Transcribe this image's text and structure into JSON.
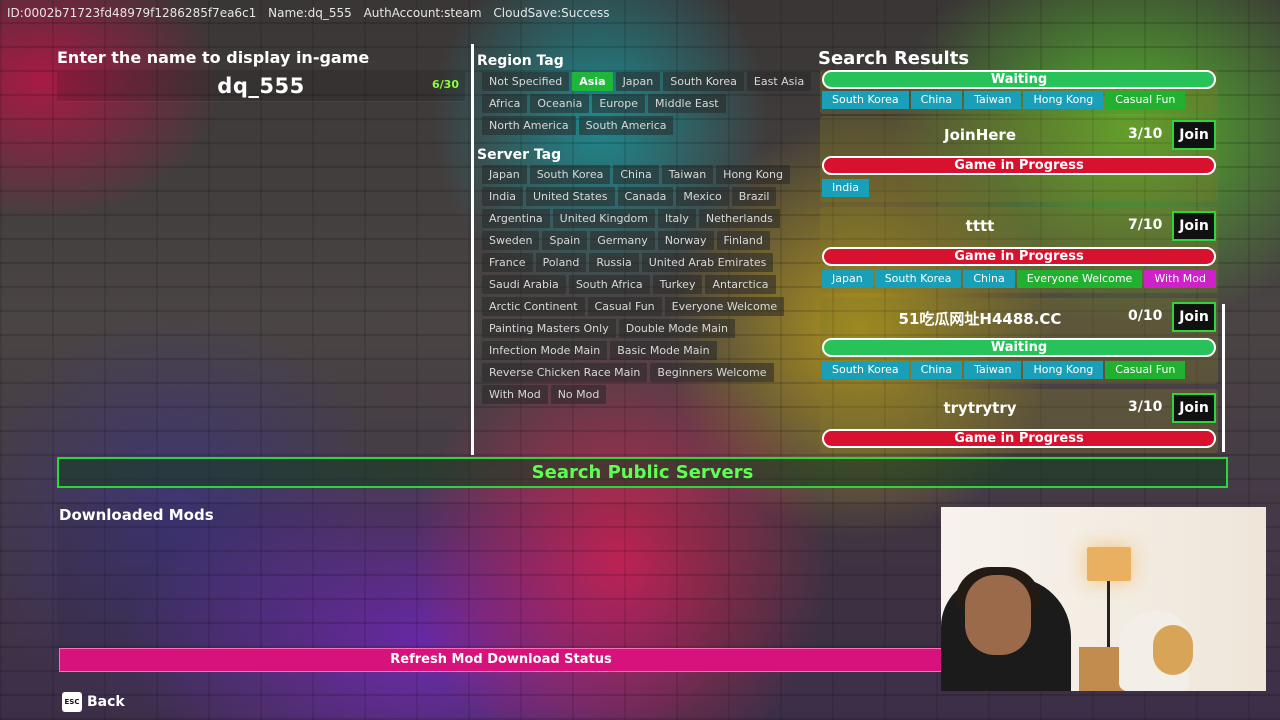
{
  "topbar": {
    "id": "ID:0002b71723fd48979f1286285f7ea6c1",
    "name": "Name:dq_555",
    "auth": "AuthAccount:steam",
    "cloud": "CloudSave:Success"
  },
  "name_entry": {
    "label": "Enter the name to display in-game",
    "value": "dq_555",
    "count": "6/30"
  },
  "region_tag": {
    "title": "Region Tag",
    "tags": [
      "Not Specified",
      "Asia",
      "Japan",
      "South Korea",
      "East Asia",
      "Africa",
      "Oceania",
      "Europe",
      "Middle East",
      "North America",
      "South America"
    ],
    "selected": "Asia"
  },
  "server_tag": {
    "title": "Server Tag",
    "tags": [
      "Japan",
      "South Korea",
      "China",
      "Taiwan",
      "Hong Kong",
      "India",
      "United States",
      "Canada",
      "Mexico",
      "Brazil",
      "Argentina",
      "United Kingdom",
      "Italy",
      "Netherlands",
      "Sweden",
      "Spain",
      "Germany",
      "Norway",
      "Finland",
      "France",
      "Poland",
      "Russia",
      "United Arab Emirates",
      "Saudi Arabia",
      "South Africa",
      "Turkey",
      "Antarctica",
      "Arctic Continent",
      "Casual Fun",
      "Everyone Welcome",
      "Painting Masters Only",
      "Double Mode Main",
      "Infection Mode Main",
      "Basic Mode Main",
      "Reverse Chicken Race Main",
      "Beginners Welcome",
      "With Mod",
      "No Mod"
    ]
  },
  "results": {
    "title": "Search Results",
    "join_label": "Join",
    "partial_top": {
      "status": "Waiting",
      "tags": [
        "South Korea",
        "China",
        "Taiwan",
        "Hong Kong",
        "Casual Fun"
      ]
    },
    "servers": [
      {
        "name": "JoinHere",
        "count": "3/10",
        "status": "Game in Progress",
        "tags": [
          "India"
        ]
      },
      {
        "name": "tttt",
        "count": "7/10",
        "status": "Game in Progress",
        "tags": [
          "Japan",
          "South Korea",
          "China",
          "Everyone Welcome",
          "With Mod"
        ]
      },
      {
        "name": "51吃瓜网址H4488.CC",
        "count": "0/10",
        "status": "Waiting",
        "tags": [
          "South Korea",
          "China",
          "Taiwan",
          "Hong Kong",
          "Casual Fun"
        ]
      },
      {
        "name": "trytrytry",
        "count": "3/10",
        "status": "Game in Progress",
        "tags": []
      }
    ]
  },
  "search_button": "Search Public Servers",
  "mods": {
    "title": "Downloaded Mods",
    "refresh": "Refresh Mod Download Status"
  },
  "back": {
    "key": "ESC",
    "label": "Back"
  },
  "colors": {
    "accent_green": "#2bd53c",
    "waiting": "#28c25b",
    "in_progress": "#d8112e",
    "chip_default": "#1a9fb8",
    "chip_green": "#22b030",
    "chip_pink": "#cc22c8",
    "refresh": "#d8127c"
  }
}
